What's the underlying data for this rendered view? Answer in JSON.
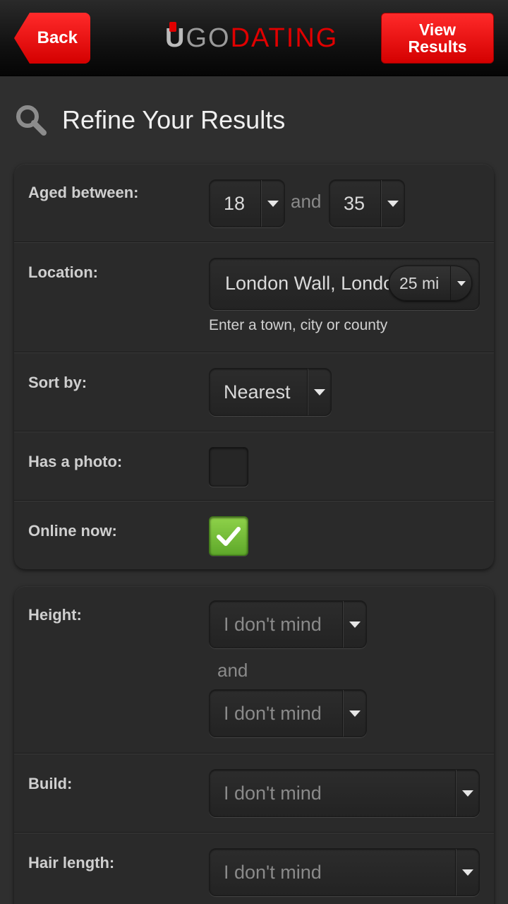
{
  "header": {
    "back_label": "Back",
    "view_results_label": "View Results",
    "logo": {
      "u": "U",
      "go": "GO",
      "dating": "DATING"
    }
  },
  "title": "Refine Your Results",
  "panel1": {
    "age": {
      "label": "Aged between:",
      "min": "18",
      "and": "and",
      "max": "35"
    },
    "location": {
      "label": "Location:",
      "value": "London Wall, London",
      "radius": "25 mi",
      "hint": "Enter a town, city or county"
    },
    "sort": {
      "label": "Sort by:",
      "value": "Nearest"
    },
    "photo": {
      "label": "Has a photo:",
      "checked": false
    },
    "online": {
      "label": "Online now:",
      "checked": true
    }
  },
  "panel2": {
    "height": {
      "label": "Height:",
      "min": "I don't mind",
      "and": "and",
      "max": "I don't mind"
    },
    "build": {
      "label": "Build:",
      "value": "I don't mind"
    },
    "hair": {
      "label": "Hair length:",
      "value": "I don't mind"
    }
  },
  "colors": {
    "accent": "#e00000",
    "check": "#6cbf2f",
    "bg": "#2f2f2f"
  }
}
